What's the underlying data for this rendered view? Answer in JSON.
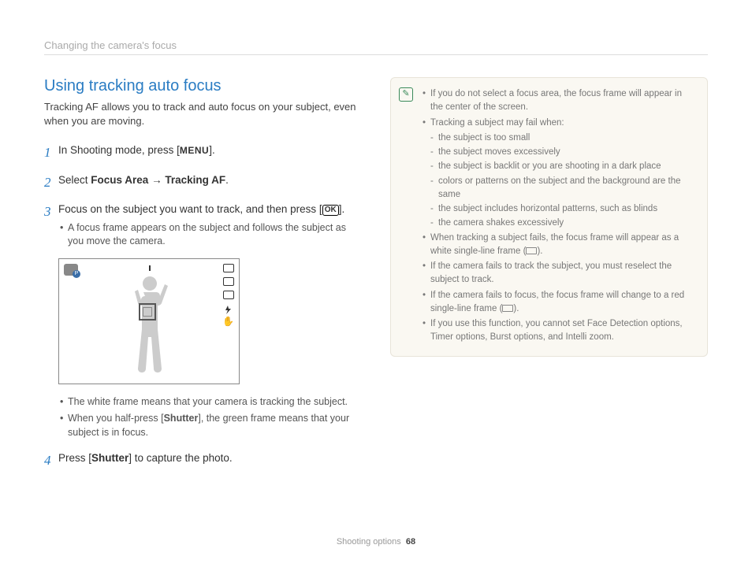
{
  "breadcrumb": "Changing the camera's focus",
  "title": "Using tracking auto focus",
  "intro": "Tracking AF allows you to track and auto focus on your subject, even when you are moving.",
  "steps": {
    "s1": {
      "pre": "In Shooting mode, press [",
      "post": "]."
    },
    "s2": {
      "pre": "Select ",
      "b1": "Focus Area",
      "arrow": " → ",
      "b2": "Tracking AF",
      "post": "."
    },
    "s3": {
      "pre": "Focus on the subject you want to track, and then press [",
      "post": "].",
      "sub": "A focus frame appears on the subject and follows the subject as you move the camera."
    },
    "post3a": "The white frame means that your camera is tracking the subject.",
    "post3b_pre": "When you half-press [",
    "post3b_b": "Shutter",
    "post3b_post": "], the green frame means that your subject is in focus.",
    "s4": {
      "pre": "Press [",
      "b": "Shutter",
      "post": "] to capture the photo."
    }
  },
  "notes": {
    "n1": "If you do not select a focus area, the focus frame will appear in the center of the screen.",
    "n2": "Tracking a subject may fail when:",
    "n2a": "the subject is too small",
    "n2b": "the subject moves excessively",
    "n2c": "the subject is backlit or you are shooting in a dark place",
    "n2d": "colors or patterns on the subject and the background are the same",
    "n2e": "the subject includes horizontal patterns, such as blinds",
    "n2f": "the camera shakes excessively",
    "n3a": "When tracking a subject fails, the focus frame will appear as a white single-line frame (",
    "n3b": ").",
    "n4": "If the camera fails to track the subject, you must reselect the subject to track.",
    "n5a": "If the camera fails to focus, the focus frame will change to a red single-line frame (",
    "n5b": ").",
    "n6": "If you use this function, you cannot set Face Detection options, Timer options, Burst options, and Intelli zoom."
  },
  "footer": {
    "section": "Shooting options",
    "page": "68"
  }
}
